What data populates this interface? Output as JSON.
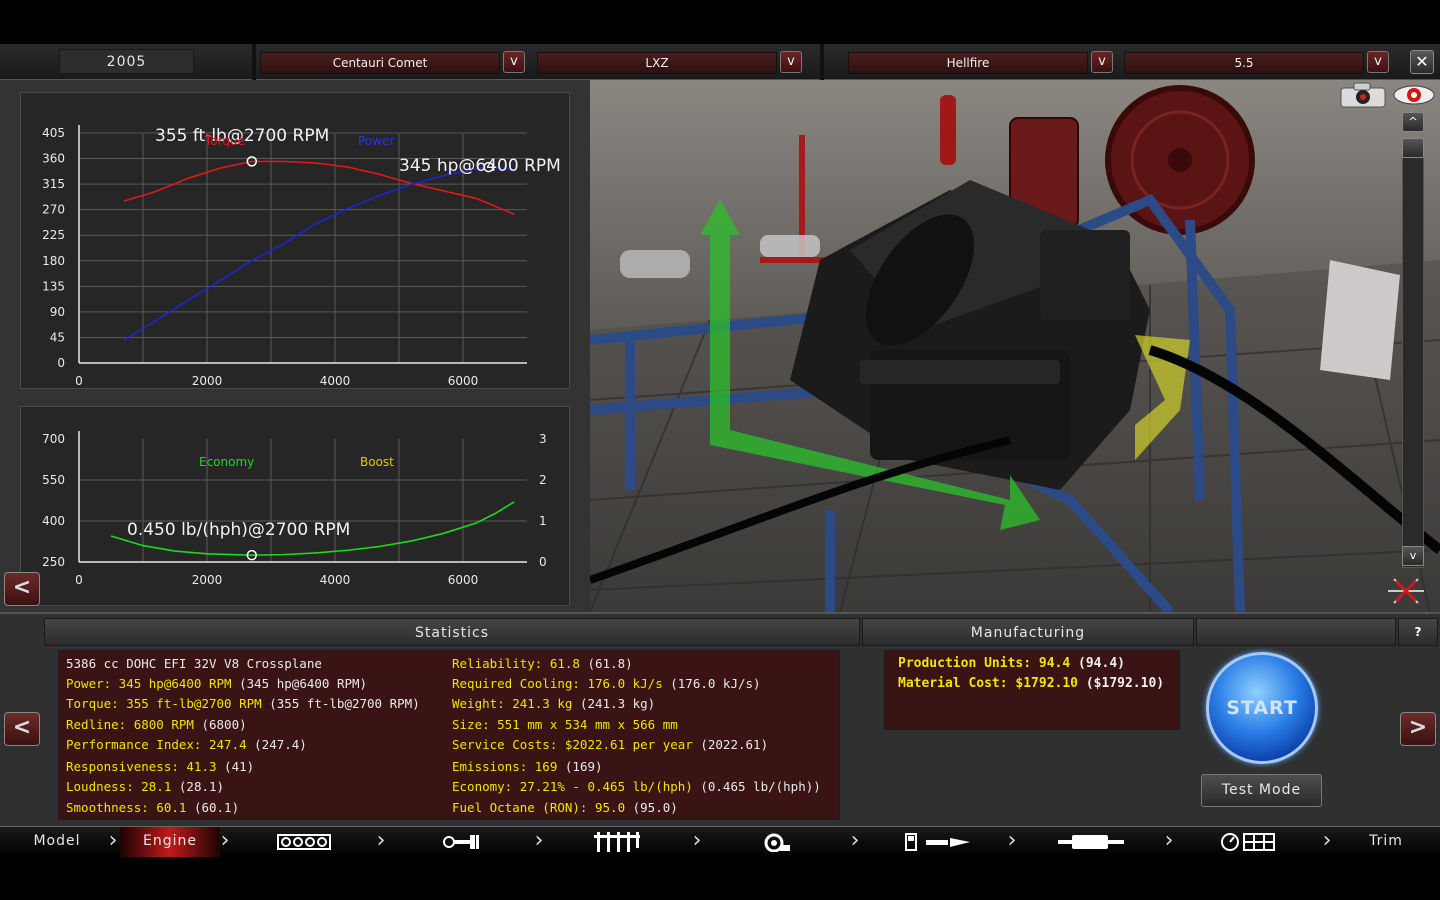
{
  "topbar": {
    "year": "2005",
    "family": "Centauri Comet",
    "variant": "LXZ",
    "engine_family": "Hellfire",
    "engine_variant": "5.5",
    "dropdown_glyph": "v",
    "close_glyph": "✕"
  },
  "graphs": {
    "power_torque": {
      "y_ticks": [
        "405",
        "360",
        "315",
        "270",
        "225",
        "180",
        "135",
        "90",
        "45",
        "0"
      ],
      "x_ticks": [
        "0",
        "2000",
        "4000",
        "6000"
      ],
      "torque_legend": "Torque",
      "power_legend": "Power",
      "torque_peak": "355 ft-lb@2700 RPM",
      "power_peak": "345 hp@6400 RPM"
    },
    "economy_boost": {
      "y_left_ticks": [
        "700",
        "550",
        "400",
        "250"
      ],
      "y_right_ticks": [
        "3",
        "2",
        "1",
        "0"
      ],
      "x_ticks": [
        "0",
        "2000",
        "4000",
        "6000"
      ],
      "economy_legend": "Economy",
      "boost_legend": "Boost",
      "economy_peak": "0.450 lb/(hph)@2700 RPM"
    }
  },
  "chart_data": [
    {
      "type": "line",
      "title": "",
      "xlabel": "",
      "ylabel": "",
      "xlim": [
        0,
        7000
      ],
      "ylim": [
        0,
        405
      ],
      "grid": true,
      "legend": "top-center",
      "series": [
        {
          "name": "Torque",
          "color": "#e01818",
          "x": [
            700,
            1200,
            1700,
            2200,
            2700,
            3200,
            3700,
            4200,
            4700,
            5200,
            5700,
            6200,
            6800
          ],
          "y": [
            285,
            302,
            325,
            343,
            355,
            355,
            352,
            345,
            332,
            316,
            303,
            290,
            262
          ]
        },
        {
          "name": "Power",
          "color": "#1c25d8",
          "x": [
            700,
            1200,
            1700,
            2200,
            2700,
            3200,
            3700,
            4200,
            4700,
            5200,
            5700,
            6200,
            6400,
            6800
          ],
          "y": [
            40,
            75,
            110,
            145,
            180,
            210,
            245,
            272,
            295,
            315,
            330,
            342,
            345,
            341
          ]
        }
      ],
      "annotations": [
        {
          "text": "355 ft-lb@2700 RPM",
          "x": 2700,
          "y": 355
        },
        {
          "text": "345 hp@6400 RPM",
          "x": 6400,
          "y": 345
        }
      ]
    },
    {
      "type": "line",
      "title": "",
      "xlabel": "",
      "ylabel": "",
      "xlim": [
        0,
        7000
      ],
      "ylim": [
        250,
        700
      ],
      "y2lim": [
        0,
        3
      ],
      "grid": true,
      "legend": "top-center",
      "series": [
        {
          "name": "Economy",
          "color": "#1ed81e",
          "x": [
            500,
            1000,
            1500,
            2000,
            2700,
            3200,
            3700,
            4200,
            4700,
            5200,
            5700,
            6200,
            6500,
            6800
          ],
          "y": [
            345,
            310,
            290,
            280,
            275,
            277,
            283,
            293,
            307,
            327,
            355,
            392,
            427,
            470
          ]
        },
        {
          "name": "Boost",
          "color": "#d6d000",
          "x": [],
          "y": []
        }
      ],
      "annotations": [
        {
          "text": "0.450 lb/(hph)@2700 RPM",
          "x": 2700,
          "y": 275
        }
      ]
    }
  ],
  "statistics": {
    "header": "Statistics",
    "left": [
      {
        "label": "5386 cc DOHC EFI 32V V8 Crossplane",
        "value": ""
      },
      {
        "label": "Power: 345 hp@6400 RPM",
        "value": "(345 hp@6400 RPM)"
      },
      {
        "label": "Torque: 355 ft-lb@2700 RPM",
        "value": "(355 ft-lb@2700 RPM)"
      },
      {
        "label": "Redline: 6800 RPM",
        "value": "(6800)"
      },
      {
        "label": "Performance Index: 247.4",
        "value": "(247.4)"
      },
      {
        "label": "Responsiveness: 41.3",
        "value": "(41)"
      },
      {
        "label": "Loudness: 28.1",
        "value": "(28.1)"
      },
      {
        "label": "Smoothness: 60.1",
        "value": "(60.1)"
      }
    ],
    "right": [
      {
        "label": "Reliability: 61.8",
        "value": "(61.8)"
      },
      {
        "label": "Required Cooling: 176.0 kJ/s",
        "value": "(176.0 kJ/s)"
      },
      {
        "label": "Weight: 241.3 kg",
        "value": "(241.3 kg)"
      },
      {
        "label": "Size: 551 mm x 534 mm x 566 mm",
        "value": ""
      },
      {
        "label": "Service Costs: $2022.61 per year",
        "value": "(2022.61)"
      },
      {
        "label": "Emissions: 169",
        "value": "(169)"
      },
      {
        "label": "Economy: 27.21% - 0.465 lb/(hph)",
        "value": "(0.465 lb/(hph))"
      },
      {
        "label": "Fuel Octane (RON): 95.0",
        "value": "(95.0)"
      }
    ]
  },
  "manufacturing": {
    "header": "Manufacturing",
    "rows": [
      {
        "label": "Production Units: 94.4",
        "value": "(94.4)"
      },
      {
        "label": "Material Cost: $1792.10",
        "value": "($1792.10)"
      }
    ]
  },
  "actions": {
    "start": "START",
    "test_mode": "Test Mode",
    "help": "?",
    "prev": "<",
    "next": ">"
  },
  "viewport": {
    "scroll_up": "^",
    "scroll_down": "v"
  },
  "nav": {
    "model": "Model",
    "engine": "Engine",
    "trim": "Trim",
    "icons": [
      "bottom-end-icon",
      "top-end-icon",
      "intake-manifold-icon",
      "turbo-icon",
      "fuel-system-icon",
      "exhaust-icon",
      "tuning-gauge-icon"
    ]
  },
  "colors": {
    "accent_red": "#c11a1a",
    "stat_yellow": "#f0e400",
    "start_blue": "#2a7de6"
  }
}
